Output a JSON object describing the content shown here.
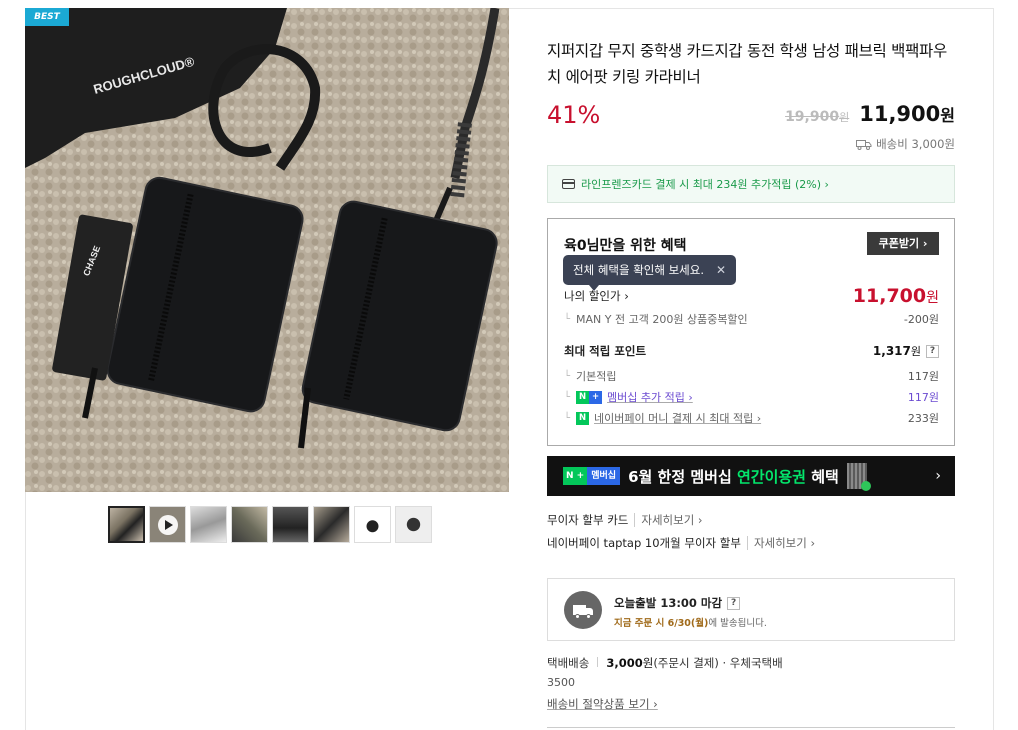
{
  "gallery": {
    "badge": "BEST",
    "brand_text": "ROUGHCLOUD®",
    "card_text": "CHASE",
    "thumbnails_count": 8,
    "active_thumbnail": 0
  },
  "product": {
    "title": "지퍼지갑 무지 중학생 카드지갑 동전 학생 남성 패브릭 백팩파우치 에어팟 키링 카라비너",
    "discount_rate": "41%",
    "original_price": "19,900",
    "original_price_unit": "원",
    "sale_price": "11,900",
    "sale_price_unit": "원",
    "shipping_fee": "배송비 3,000원"
  },
  "card_banner": {
    "text": "라인프렌즈카드 결제 시 최대 234원 추가적립 (2%) ›"
  },
  "benefit": {
    "title": "육0님만을 위한 혜택",
    "coupon_button": "쿠폰받기 ›",
    "tooltip": "전체 혜택을 확인해 보세요.",
    "tooltip_close": "✕",
    "my_discount_label": "나의 할인가 ›",
    "my_discount_price": "11,700",
    "my_discount_unit": "원",
    "coupon_line_label": "MAN Y 전 고객 200원 상품중복할인",
    "coupon_line_value": "-200원",
    "max_points_label": "최대 적립 포인트",
    "max_points_value": "1,317",
    "max_points_unit": "원",
    "qmark": "?",
    "basic_label": "기본적립",
    "basic_value": "117원",
    "member_label": "멤버십 추가 적립 ›",
    "member_value": "117원",
    "naverpay_label": "네이버페이 머니 결제 시 최대 적립 ›",
    "naverpay_value": "233원"
  },
  "member_banner": {
    "badge_n": "N +",
    "badge_text": "멤버십",
    "text_prefix": "6월 한정 멤버십 ",
    "text_highlight": "연간이용권",
    "text_suffix": " 혜택",
    "arrow": "›"
  },
  "installment": {
    "line1": "무이자 할부 카드",
    "line1_more": "자세히보기 ›",
    "line2": "네이버페이 taptap 10개월 무이자 할부",
    "line2_more": "자세히보기 ›"
  },
  "delivery": {
    "title": "오늘출발 13:00 마감",
    "qmark": "?",
    "sub_bold": "지금 주문 시 6/30(월)",
    "sub_rest": "에 발송됩니다."
  },
  "shipping": {
    "method": "택배배송",
    "fee": "3,000",
    "fee_unit": "원",
    "fee_note": "(주문시 결제)",
    "carrier": "· 우체국택배",
    "extra": "3500",
    "link": "배송비 절약상품 보기 ›"
  },
  "colors": {
    "discount_red": "#c8102e",
    "naver_green": "#03c75a",
    "member_purple": "#6b4bd1",
    "badge_blue": "#1ba9d4"
  }
}
